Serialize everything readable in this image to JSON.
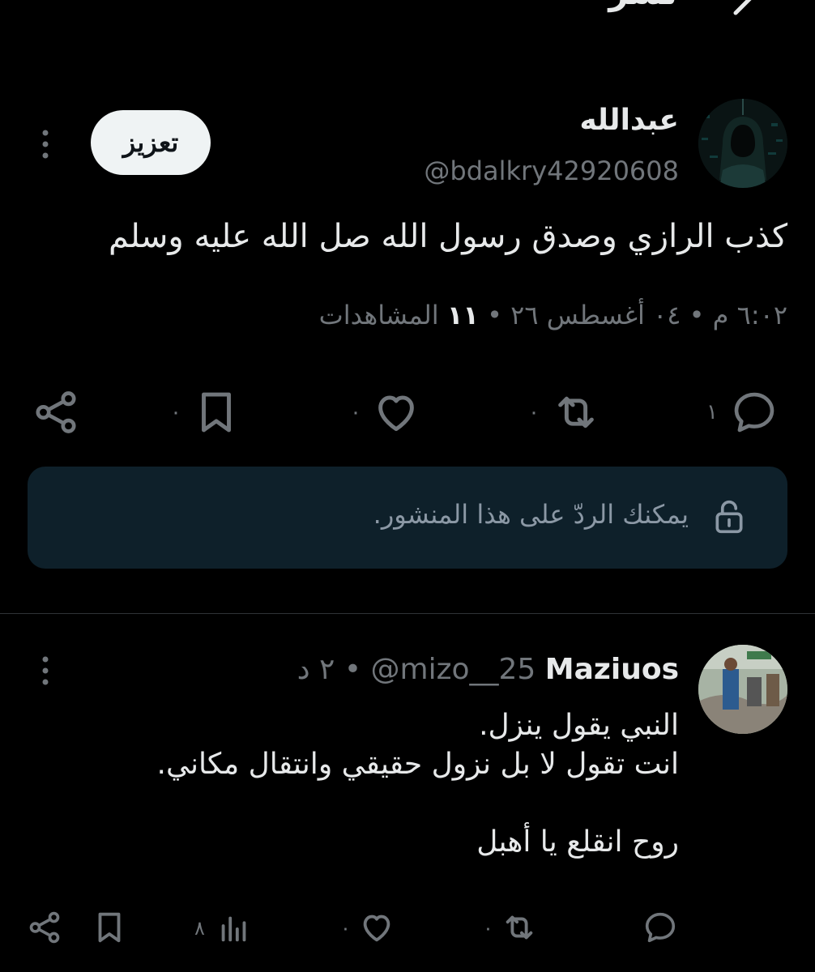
{
  "header": {
    "title": "نشر"
  },
  "post": {
    "author_name": "عبدالله",
    "author_handle": "@bdalkry42920608",
    "boost_label": "تعزيز",
    "text": "كذب الرازي وصدق رسول الله صل الله عليه وسلم",
    "time": "٦:٠٢ م",
    "date": "٠٤ أغسطس ٢٦",
    "views_count": "١١",
    "views_label": "المشاهدات",
    "actions": {
      "reply_count": "١",
      "repost_count": "٠",
      "like_count": "٠",
      "bookmark_count": "٠"
    },
    "reply_notice": "يمكنك الردّ على هذا المنشور."
  },
  "reply": {
    "author_name": "Maziuos",
    "author_handle": "@mizo__25",
    "age": "٢ د",
    "lines": [
      "النبي يقول ينزل.",
      "انت تقول لا بل نزول حقيقي وانتقال مكاني.",
      "",
      "روح انقلع يا أهبل"
    ],
    "actions": {
      "reply_count": "",
      "repost_count": "٠",
      "like_count": "٠",
      "views_count": "٨"
    }
  },
  "colors": {
    "background": "#000000",
    "text": "#e7e9ea",
    "muted": "#71767b",
    "notice_bg": "#0e202a"
  }
}
